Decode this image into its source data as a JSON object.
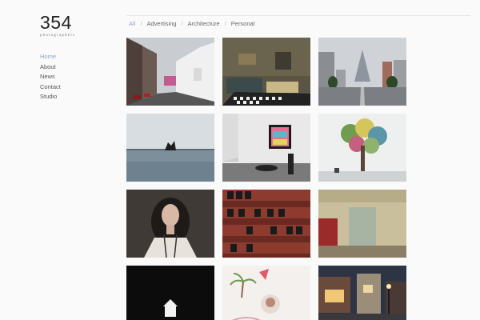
{
  "logo": {
    "number": "354",
    "subtitle": "photographers"
  },
  "nav": {
    "items": [
      "Home",
      "About",
      "News",
      "Contact",
      "Studio"
    ],
    "active": "Home"
  },
  "filters": {
    "items": [
      "All",
      "Advertising",
      "Architecture",
      "Personal"
    ],
    "active": "All",
    "separator": "/"
  }
}
